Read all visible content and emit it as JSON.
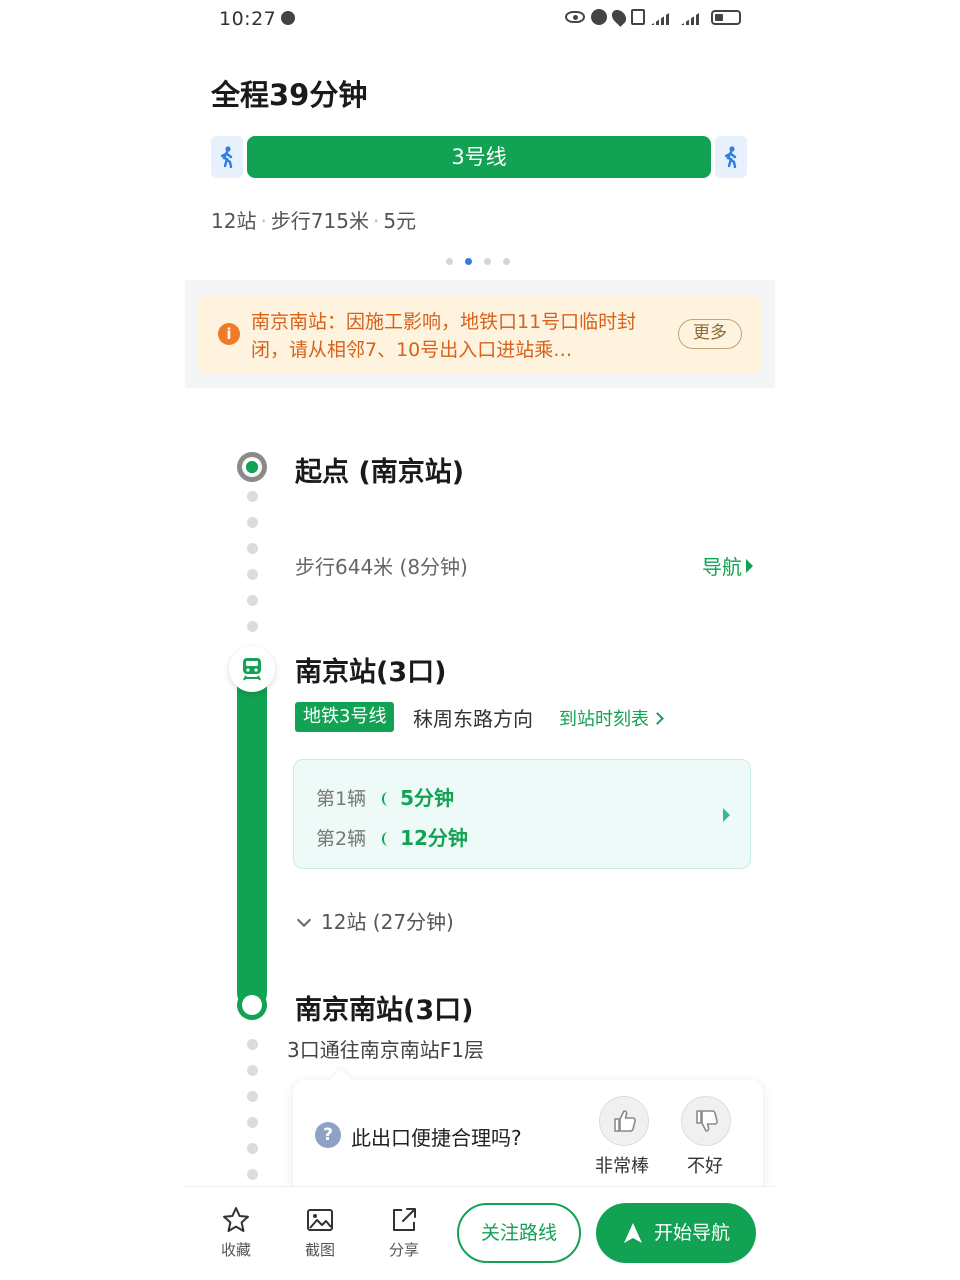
{
  "status_bar": {
    "time": "10:27"
  },
  "header": {
    "total_time": "全程39分钟",
    "route_line_label": "3号线",
    "summary": {
      "stations": "12站",
      "walk": "步行715米",
      "fare": "5元"
    }
  },
  "notice": {
    "text": "南京南站：因施工影响，地铁口11号口临时封闭，请从相邻7、10号出入口进站乘…",
    "more_label": "更多"
  },
  "steps": {
    "start": {
      "title": "起点 (南京站)"
    },
    "walk": {
      "text": "步行644米 (8分钟)",
      "nav_label": "导航"
    },
    "board": {
      "title": "南京站(3口)",
      "line_badge": "地铁3号线",
      "direction": "秣周东路方向",
      "timetable_label": "到站时刻表",
      "arrivals": [
        {
          "label": "第1辆",
          "minutes": "5分钟"
        },
        {
          "label": "第2辆",
          "minutes": "12分钟"
        }
      ],
      "stops_toggle": "12站 (27分钟)"
    },
    "end": {
      "title": "南京南站(3口)",
      "exit_note": "3口通往南京南站F1层"
    }
  },
  "feedback": {
    "question": "此出口便捷合理吗?",
    "up_label": "非常棒",
    "down_label": "不好"
  },
  "bottom_bar": {
    "favorite_label": "收藏",
    "screenshot_label": "截图",
    "share_label": "分享",
    "follow_label": "关注路线",
    "start_nav_label": "开始导航"
  },
  "colors": {
    "brand_green": "#12a253",
    "notice_orange": "#d8621c",
    "page_indicator": "#2f7de1"
  }
}
